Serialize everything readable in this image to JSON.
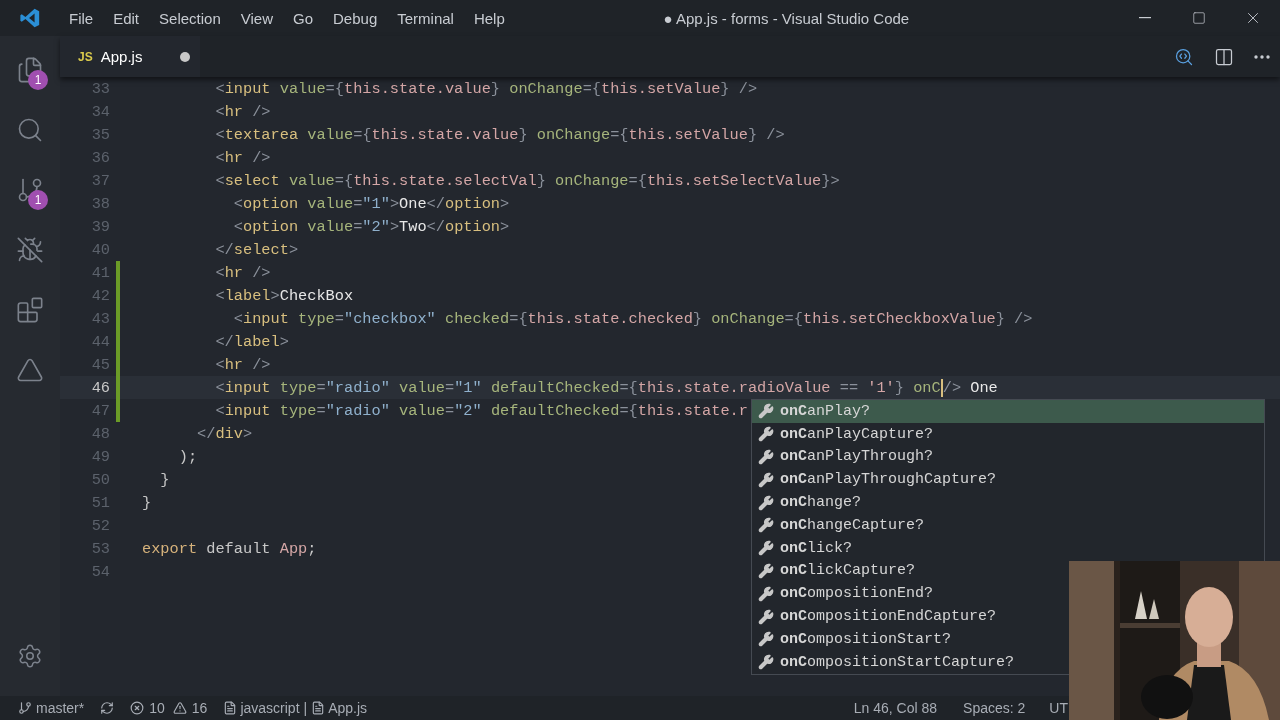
{
  "menu": [
    "File",
    "Edit",
    "Selection",
    "View",
    "Go",
    "Debug",
    "Terminal",
    "Help"
  ],
  "window": {
    "title": "● App.js - forms - Visual Studio Code"
  },
  "activity_bar": [
    {
      "kind": "files",
      "badge": "1"
    },
    {
      "kind": "search"
    },
    {
      "kind": "source-control",
      "badge": "1"
    },
    {
      "kind": "debug"
    },
    {
      "kind": "extensions"
    },
    {
      "kind": "deploy"
    }
  ],
  "tabs": [
    {
      "icon": "JS",
      "label": "App.js",
      "dirty": true,
      "selected": true
    }
  ],
  "editor": {
    "lines": [
      {
        "number": "33",
        "modified": false,
        "current": false,
        "tokens": [
          {
            "kind": "punct",
            "text": "        <"
          },
          {
            "kind": "tag",
            "text": "input"
          },
          {
            "kind": "attr",
            "text": " value"
          },
          {
            "kind": "punct",
            "text": "={"
          },
          {
            "kind": "var",
            "text": "this.state.value"
          },
          {
            "kind": "punct",
            "text": "} "
          },
          {
            "kind": "attr",
            "text": "onChange"
          },
          {
            "kind": "punct",
            "text": "={"
          },
          {
            "kind": "var",
            "text": "this.setValue"
          },
          {
            "kind": "punct",
            "text": "} />"
          }
        ]
      },
      {
        "number": "34",
        "modified": false,
        "current": false,
        "tokens": [
          {
            "kind": "punct",
            "text": "        <"
          },
          {
            "kind": "tag",
            "text": "hr"
          },
          {
            "kind": "punct",
            "text": " />"
          }
        ]
      },
      {
        "number": "35",
        "modified": false,
        "current": false,
        "tokens": [
          {
            "kind": "punct",
            "text": "        <"
          },
          {
            "kind": "tag",
            "text": "textarea"
          },
          {
            "kind": "attr",
            "text": " value"
          },
          {
            "kind": "punct",
            "text": "={"
          },
          {
            "kind": "var",
            "text": "this.state.value"
          },
          {
            "kind": "punct",
            "text": "} "
          },
          {
            "kind": "attr",
            "text": "onChange"
          },
          {
            "kind": "punct",
            "text": "={"
          },
          {
            "kind": "var",
            "text": "this.setValue"
          },
          {
            "kind": "punct",
            "text": "} />"
          }
        ]
      },
      {
        "number": "36",
        "modified": false,
        "current": false,
        "tokens": [
          {
            "kind": "punct",
            "text": "        <"
          },
          {
            "kind": "tag",
            "text": "hr"
          },
          {
            "kind": "punct",
            "text": " />"
          }
        ]
      },
      {
        "number": "37",
        "modified": false,
        "current": false,
        "tokens": [
          {
            "kind": "punct",
            "text": "        <"
          },
          {
            "kind": "tag",
            "text": "select"
          },
          {
            "kind": "attr",
            "text": " value"
          },
          {
            "kind": "punct",
            "text": "={"
          },
          {
            "kind": "var",
            "text": "this.state.selectVal"
          },
          {
            "kind": "punct",
            "text": "} "
          },
          {
            "kind": "attr",
            "text": "onChange"
          },
          {
            "kind": "punct",
            "text": "={"
          },
          {
            "kind": "var",
            "text": "this.setSelectValue"
          },
          {
            "kind": "punct",
            "text": "}>"
          }
        ]
      },
      {
        "number": "38",
        "modified": false,
        "current": false,
        "tokens": [
          {
            "kind": "punct",
            "text": "          <"
          },
          {
            "kind": "tag",
            "text": "option"
          },
          {
            "kind": "attr",
            "text": " value"
          },
          {
            "kind": "punct",
            "text": "="
          },
          {
            "kind": "string",
            "text": "\"1\""
          },
          {
            "kind": "punct",
            "text": ">"
          },
          {
            "kind": "text",
            "text": "One"
          },
          {
            "kind": "punct",
            "text": "</"
          },
          {
            "kind": "tag",
            "text": "option"
          },
          {
            "kind": "punct",
            "text": ">"
          }
        ]
      },
      {
        "number": "39",
        "modified": false,
        "current": false,
        "tokens": [
          {
            "kind": "punct",
            "text": "          <"
          },
          {
            "kind": "tag",
            "text": "option"
          },
          {
            "kind": "attr",
            "text": " value"
          },
          {
            "kind": "punct",
            "text": "="
          },
          {
            "kind": "string",
            "text": "\"2\""
          },
          {
            "kind": "punct",
            "text": ">"
          },
          {
            "kind": "text",
            "text": "Two"
          },
          {
            "kind": "punct",
            "text": "</"
          },
          {
            "kind": "tag",
            "text": "option"
          },
          {
            "kind": "punct",
            "text": ">"
          }
        ]
      },
      {
        "number": "40",
        "modified": false,
        "current": false,
        "tokens": [
          {
            "kind": "punct",
            "text": "        </"
          },
          {
            "kind": "tag",
            "text": "select"
          },
          {
            "kind": "punct",
            "text": ">"
          }
        ]
      },
      {
        "number": "41",
        "modified": true,
        "current": false,
        "tokens": [
          {
            "kind": "punct",
            "text": "        <"
          },
          {
            "kind": "tag",
            "text": "hr"
          },
          {
            "kind": "punct",
            "text": " />"
          }
        ]
      },
      {
        "number": "42",
        "modified": true,
        "current": false,
        "tokens": [
          {
            "kind": "punct",
            "text": "        <"
          },
          {
            "kind": "tag",
            "text": "label"
          },
          {
            "kind": "punct",
            "text": ">"
          },
          {
            "kind": "text",
            "text": "CheckBox"
          }
        ]
      },
      {
        "number": "43",
        "modified": true,
        "current": false,
        "tokens": [
          {
            "kind": "punct",
            "text": "          <"
          },
          {
            "kind": "tag",
            "text": "input"
          },
          {
            "kind": "attr",
            "text": " type"
          },
          {
            "kind": "punct",
            "text": "="
          },
          {
            "kind": "string",
            "text": "\"checkbox\""
          },
          {
            "kind": "attr",
            "text": " checked"
          },
          {
            "kind": "punct",
            "text": "={"
          },
          {
            "kind": "var",
            "text": "this.state.checked"
          },
          {
            "kind": "punct",
            "text": "} "
          },
          {
            "kind": "attr",
            "text": "onChange"
          },
          {
            "kind": "punct",
            "text": "={"
          },
          {
            "kind": "var",
            "text": "this.setCheckboxValue"
          },
          {
            "kind": "punct",
            "text": "} />"
          }
        ]
      },
      {
        "number": "44",
        "modified": true,
        "current": false,
        "tokens": [
          {
            "kind": "punct",
            "text": "        </"
          },
          {
            "kind": "tag",
            "text": "label"
          },
          {
            "kind": "punct",
            "text": ">"
          }
        ]
      },
      {
        "number": "45",
        "modified": true,
        "current": false,
        "tokens": [
          {
            "kind": "punct",
            "text": "        <"
          },
          {
            "kind": "tag",
            "text": "hr"
          },
          {
            "kind": "punct",
            "text": " />"
          }
        ]
      },
      {
        "number": "46",
        "modified": true,
        "current": true,
        "tokens": [
          {
            "kind": "punct",
            "text": "        <"
          },
          {
            "kind": "tag",
            "text": "input"
          },
          {
            "kind": "attr",
            "text": " type"
          },
          {
            "kind": "punct",
            "text": "="
          },
          {
            "kind": "string",
            "text": "\"radio\""
          },
          {
            "kind": "attr",
            "text": " value"
          },
          {
            "kind": "punct",
            "text": "="
          },
          {
            "kind": "string",
            "text": "\"1\""
          },
          {
            "kind": "attr",
            "text": " defaultChecked"
          },
          {
            "kind": "punct",
            "text": "={"
          },
          {
            "kind": "var",
            "text": "this.state.radioValue"
          },
          {
            "kind": "punct",
            "text": " == "
          },
          {
            "kind": "var",
            "text": "'1'"
          },
          {
            "kind": "punct",
            "text": "} "
          },
          {
            "kind": "typed",
            "text": "onC"
          },
          {
            "kind": "punct",
            "text": "/> "
          },
          {
            "kind": "text",
            "text": "One"
          }
        ]
      },
      {
        "number": "47",
        "modified": true,
        "current": false,
        "tokens": [
          {
            "kind": "punct",
            "text": "        <"
          },
          {
            "kind": "tag",
            "text": "input"
          },
          {
            "kind": "attr",
            "text": " type"
          },
          {
            "kind": "punct",
            "text": "="
          },
          {
            "kind": "string",
            "text": "\"radio\""
          },
          {
            "kind": "attr",
            "text": " value"
          },
          {
            "kind": "punct",
            "text": "="
          },
          {
            "kind": "string",
            "text": "\"2\""
          },
          {
            "kind": "attr",
            "text": " defaultChecked"
          },
          {
            "kind": "punct",
            "text": "={"
          },
          {
            "kind": "var",
            "text": "this.state.r"
          }
        ]
      },
      {
        "number": "48",
        "modified": false,
        "current": false,
        "tokens": [
          {
            "kind": "punct",
            "text": "      </"
          },
          {
            "kind": "tag",
            "text": "div"
          },
          {
            "kind": "punct",
            "text": ">"
          }
        ]
      },
      {
        "number": "49",
        "modified": false,
        "current": false,
        "tokens": [
          {
            "kind": "plain",
            "text": "    );"
          }
        ]
      },
      {
        "number": "50",
        "modified": false,
        "current": false,
        "tokens": [
          {
            "kind": "plain",
            "text": "  }"
          }
        ]
      },
      {
        "number": "51",
        "modified": false,
        "current": false,
        "tokens": [
          {
            "kind": "plain",
            "text": "}"
          }
        ]
      },
      {
        "number": "52",
        "modified": false,
        "current": false
      },
      {
        "number": "53",
        "modified": false,
        "current": false,
        "tokens": [
          {
            "kind": "keyword",
            "text": "export"
          },
          {
            "kind": "plain",
            "text": " default "
          },
          {
            "kind": "var",
            "text": "App"
          },
          {
            "kind": "plain",
            "text": ";"
          }
        ]
      },
      {
        "number": "54",
        "modified": false,
        "current": false
      }
    ]
  },
  "suggestions": [
    {
      "label": "**onC**anPlay?",
      "selected": true
    },
    {
      "label": "**onC**anPlayCapture?",
      "selected": false
    },
    {
      "label": "**onC**anPlayThrough?",
      "selected": false
    },
    {
      "label": "**onC**anPlayThroughCapture?",
      "selected": false
    },
    {
      "label": "**onC**hange?",
      "selected": false
    },
    {
      "label": "**onC**hangeCapture?",
      "selected": false
    },
    {
      "label": "**onC**lick?",
      "selected": false
    },
    {
      "label": "**onC**lickCapture?",
      "selected": false
    },
    {
      "label": "**onC**ompositionEnd?",
      "selected": false
    },
    {
      "label": "**onC**ompositionEndCapture?",
      "selected": false
    },
    {
      "label": "**onC**ompositionStart?",
      "selected": false
    },
    {
      "label": "**onC**ompositionStartCapture?",
      "selected": false
    }
  ],
  "status_bar": {
    "branch": "master*",
    "errors": "10",
    "warnings": "16",
    "language": "javascript",
    "separator": "|",
    "file": "App.js",
    "position": "Ln 46, Col 88",
    "spaces": "Spaces: 2",
    "encoding": "UT"
  }
}
